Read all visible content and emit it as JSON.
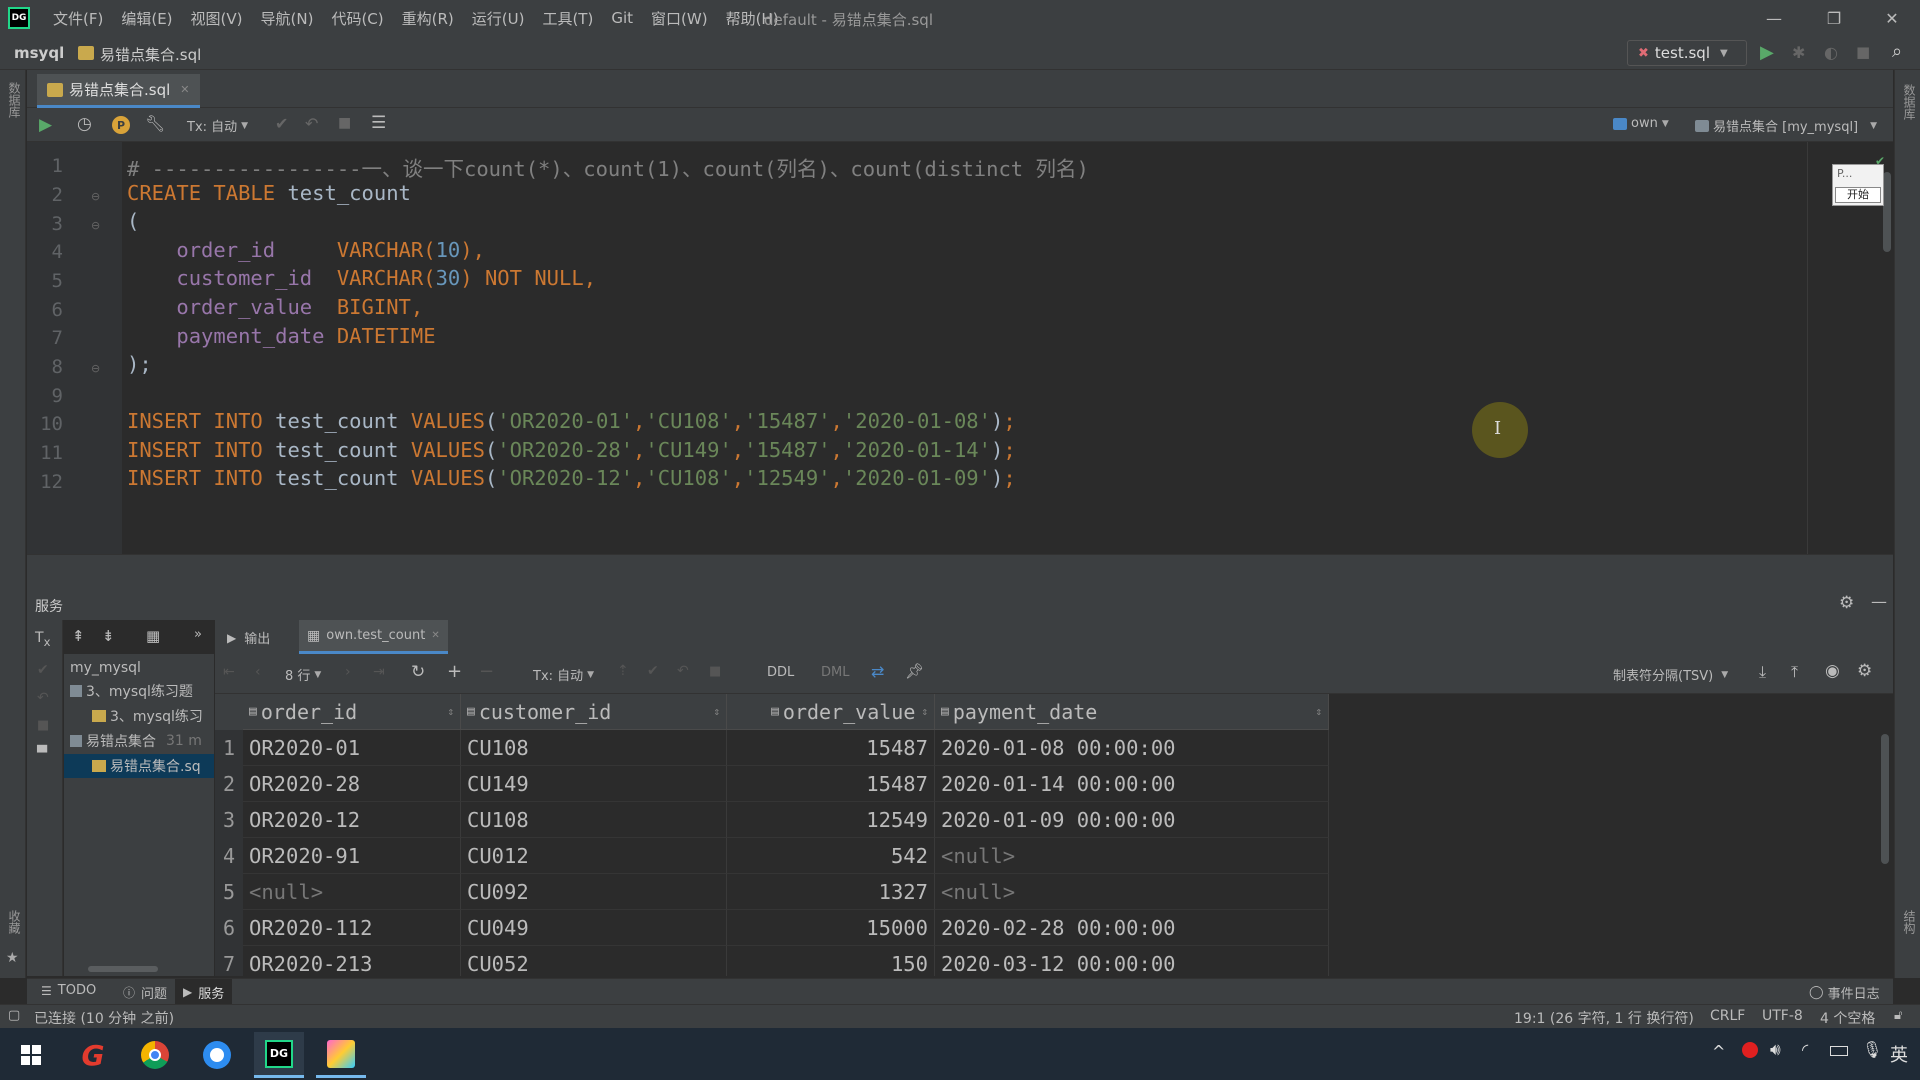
{
  "window": {
    "menu": [
      "文件(F)",
      "编辑(E)",
      "视图(V)",
      "导航(N)",
      "代码(C)",
      "重构(R)",
      "运行(U)",
      "工具(T)",
      "Git",
      "窗口(W)",
      "帮助(H)"
    ],
    "title": "default - 易错点集合.sql"
  },
  "navbar": {
    "project": "msyql",
    "file": "易错点集合.sql",
    "run_config": "test.sql"
  },
  "left_strip_label": "数据库",
  "right_strip_label": "数据库",
  "right_strip_label2": "结构",
  "left_strip_label2": "收藏",
  "editor_tab": {
    "label": "易错点集合.sql"
  },
  "editor_toolbar": {
    "tx_mode": "Tx: 自动",
    "schema": "own",
    "datasource": "易错点集合 [my_mysql]"
  },
  "floating_widget": {
    "text": "P...",
    "button": "开始"
  },
  "editor": {
    "line_numbers": [
      "1",
      "2",
      "3",
      "4",
      "5",
      "6",
      "7",
      "8",
      "9",
      "10",
      "11",
      "12"
    ],
    "lines": {
      "l1": "# -----------------一、谈一下count(*)、count(1)、count(列名)、count(distinct 列名)",
      "l2_kw": "CREATE TABLE",
      "l2_name": " test_count",
      "l3": "(",
      "l4_col": "order_id",
      "l4_type": "VARCHAR(",
      "l4_num": "10",
      "l4_end": "),",
      "l5_col": "customer_id",
      "l5_type": "VARCHAR(",
      "l5_num": "30",
      "l5_rest": ") ",
      "l5_kw": "NOT NULL",
      "l5_end": ",",
      "l6_col": "order_value",
      "l6_type": "BIGINT",
      "l6_end": ",",
      "l7_col": "payment_date",
      "l7_type": "DATETIME",
      "l8": ");",
      "inserts": [
        {
          "kw1": "INSERT INTO",
          "table": " test_count ",
          "kw2": "VALUES",
          "vals": [
            "'OR2020-01'",
            "'CU108'",
            "'15487'",
            "'2020-01-08'"
          ]
        },
        {
          "kw1": "INSERT INTO",
          "table": " test_count ",
          "kw2": "VALUES",
          "vals": [
            "'OR2020-28'",
            "'CU149'",
            "'15487'",
            "'2020-01-14'"
          ]
        },
        {
          "kw1": "INSERT INTO",
          "table": " test_count ",
          "kw2": "VALUES",
          "vals": [
            "'OR2020-12'",
            "'CU108'",
            "'12549'",
            "'2020-01-09'"
          ]
        }
      ]
    }
  },
  "services": {
    "header": "服务",
    "tree": {
      "root": "my_mysql",
      "item1": "3、mysql练习题",
      "item1_child": "3、mysql练习",
      "item2": "易错点集合",
      "item2_meta": "31 m",
      "item2_child": "易错点集合.sq"
    },
    "tabs": {
      "output": "输出",
      "result": "own.test_count"
    },
    "toolbar": {
      "rows": "8 行",
      "tx_mode": "Tx: 自动",
      "ddl": "DDL",
      "dml": "DML",
      "format": "制表符分隔(TSV)"
    }
  },
  "grid": {
    "columns": [
      "order_id",
      "customer_id",
      "order_value",
      "payment_date"
    ],
    "rows": [
      {
        "n": "1",
        "c": [
          "OR2020-01",
          "CU108",
          "15487",
          "2020-01-08 00:00:00"
        ]
      },
      {
        "n": "2",
        "c": [
          "OR2020-28",
          "CU149",
          "15487",
          "2020-01-14 00:00:00"
        ]
      },
      {
        "n": "3",
        "c": [
          "OR2020-12",
          "CU108",
          "12549",
          "2020-01-09 00:00:00"
        ]
      },
      {
        "n": "4",
        "c": [
          "OR2020-91",
          "CU012",
          "542",
          "<null>"
        ]
      },
      {
        "n": "5",
        "c": [
          "<null>",
          "CU092",
          "1327",
          "<null>"
        ]
      },
      {
        "n": "6",
        "c": [
          "OR2020-112",
          "CU049",
          "15000",
          "2020-02-28 00:00:00"
        ]
      },
      {
        "n": "7",
        "c": [
          "OR2020-213",
          "CU052",
          "150",
          "2020-03-12 00:00:00"
        ]
      }
    ]
  },
  "bottom_tools": {
    "todo": "TODO",
    "problems": "问题",
    "services": "服务",
    "event_log": "事件日志"
  },
  "status": {
    "left": "已连接 (10 分钟 之前)",
    "position": "19:1 (26 字符, 1 行 换行符)",
    "line_sep": "CRLF",
    "encoding": "UTF-8",
    "indent": "4 个空格"
  },
  "taskbar": {
    "ime": "英"
  }
}
